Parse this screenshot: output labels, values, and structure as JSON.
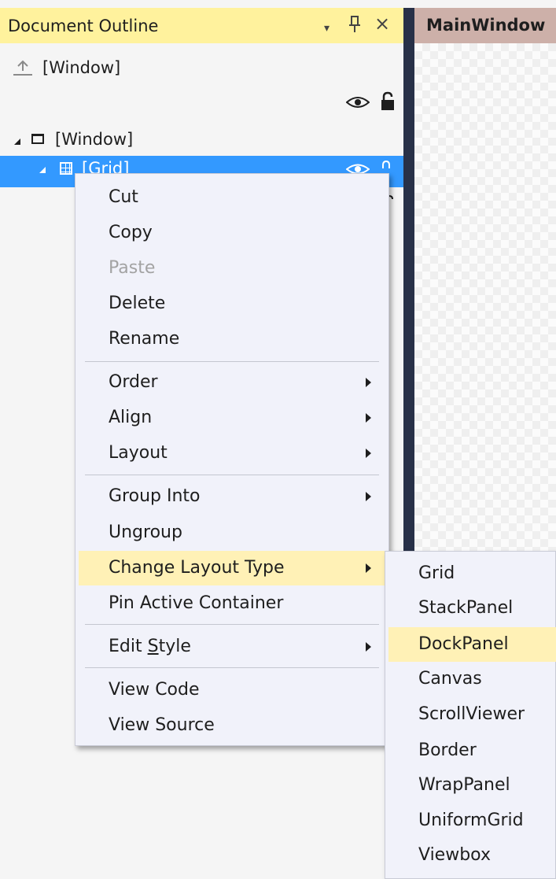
{
  "outline": {
    "title": "Document Outline",
    "header_buttons": [
      "▾",
      "⊥",
      "×"
    ],
    "up_item": "[Window]",
    "tree": [
      {
        "label": "[Window]",
        "icon": "window-icon",
        "expanded": true
      },
      {
        "label": "[Grid]",
        "icon": "grid-icon",
        "expanded": true,
        "selected": true
      }
    ]
  },
  "designer": {
    "tab_title": "MainWindow"
  },
  "context_menu": {
    "items": [
      {
        "label": "Cut"
      },
      {
        "label": "Copy"
      },
      {
        "label": "Paste",
        "disabled": true
      },
      {
        "label": "Delete"
      },
      {
        "label": "Rename"
      },
      {
        "label": "Order",
        "submenu": true
      },
      {
        "label": "Align",
        "submenu": true
      },
      {
        "label": "Layout",
        "submenu": true
      },
      {
        "label": "Group Into",
        "submenu": true
      },
      {
        "label": "Ungroup"
      },
      {
        "label": "Change Layout Type",
        "submenu": true,
        "highlighted": true
      },
      {
        "label": "Pin Active Container"
      },
      {
        "label_pre": "Edit ",
        "label_u": "S",
        "label_post": "tyle",
        "submenu": true
      },
      {
        "label": "View Code"
      },
      {
        "label": "View Source"
      }
    ]
  },
  "submenu": {
    "items": [
      {
        "label": "Grid"
      },
      {
        "label": "StackPanel"
      },
      {
        "label": "DockPanel",
        "highlighted": true
      },
      {
        "label": "Canvas"
      },
      {
        "label": "ScrollViewer"
      },
      {
        "label": "Border"
      },
      {
        "label": "WrapPanel"
      },
      {
        "label": "UniformGrid"
      },
      {
        "label": "Viewbox"
      }
    ]
  },
  "colors": {
    "header_bg": "#fff29d",
    "selection": "#3399ff",
    "menu_highlight": "#fff1b6",
    "menu_bg": "#f1f2fa",
    "splitter": "#283148",
    "tab_bg": "#cdb0a9"
  }
}
